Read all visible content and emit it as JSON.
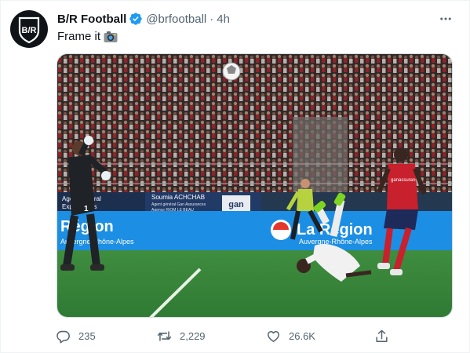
{
  "tweet": {
    "author_name": "B/R Football",
    "handle": "@brfootball",
    "separator": "·",
    "time": "4h",
    "text": "Frame it",
    "avatar_monogram": "B/R",
    "image_alt": "Photo",
    "photo_signage": {
      "board_1_line_1": "Agent général",
      "board_1_line_2": "Expert à vos",
      "board_2_line_1": "Soumia ACHCHAB",
      "board_2_line_2": "Agent général Gan Assurances",
      "board_2_line_3": "Agence RIOM LE BEAU",
      "board_3": "gan",
      "led_left": "Région",
      "led_left_sub": "Auvergne-Rhône-Alpes",
      "led_right": "La Région",
      "led_right_sub": "Auvergne-Rhône-Alpes",
      "keeper_number": "1",
      "away_shirt_sponsor": "ganassurances"
    }
  },
  "actions": {
    "replies": "235",
    "retweets": "2,229",
    "likes": "26.6K"
  },
  "colors": {
    "verified": "#1d9bf0",
    "secondary_text": "#536471",
    "pitch": "#3d8a3f",
    "led_board": "#1c8ee3"
  },
  "icons": [
    "verified-badge-icon",
    "more-icon",
    "camera-icon",
    "reply-icon",
    "retweet-icon",
    "like-icon",
    "share-icon"
  ]
}
